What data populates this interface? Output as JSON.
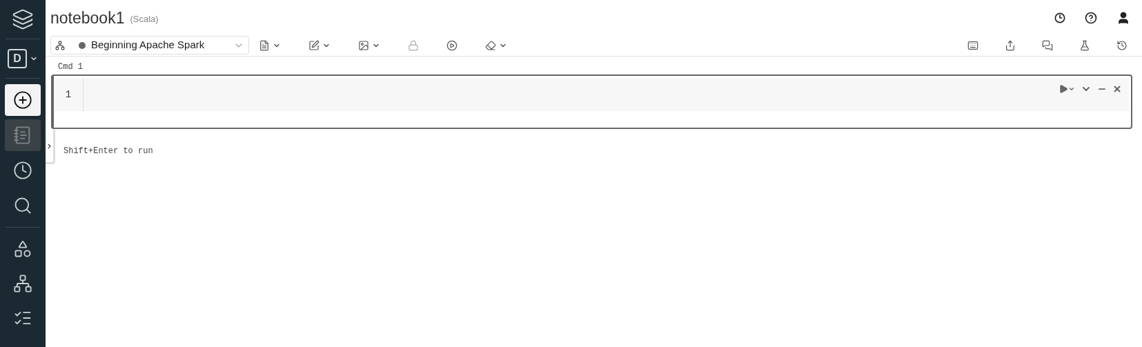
{
  "sidebar": {
    "workspace": {
      "letter": "D"
    },
    "items": [
      {
        "selected": true
      },
      {
        "selected": false
      },
      {
        "selected": false
      },
      {
        "selected": false
      },
      {
        "selected": false
      },
      {
        "selected": false
      }
    ]
  },
  "header": {
    "title": "notebook1",
    "language": "(Scala)"
  },
  "toolbar": {
    "cluster": "Beginning Apache Spark"
  },
  "cells": [
    {
      "label": "Cmd 1",
      "line_numbers": [
        "1"
      ]
    }
  ],
  "hint": "Shift+Enter to run"
}
